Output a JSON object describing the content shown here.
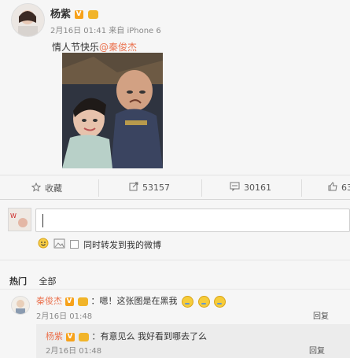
{
  "post": {
    "author": "杨紫",
    "verified_badge": "V",
    "meta": "2月16日 01:41 来自 iPhone 6",
    "text_prefix": "情人节快乐",
    "mention": "@秦俊杰"
  },
  "actions": {
    "favorite": "收藏",
    "repost_count": "53157",
    "comment_count": "30161",
    "like_count": "63"
  },
  "reply_box": {
    "sync_label": "同时转发到我的微博"
  },
  "tabs": {
    "hot": "热门",
    "all": "全部"
  },
  "comment": {
    "author": "秦俊杰",
    "verified_badge": "V",
    "text": "：嗯！这张图是在黑我",
    "time": "2月16日 01:48",
    "reply": "回复"
  },
  "nested_reply": {
    "author": "杨紫",
    "verified_badge": "V",
    "text": "：有意见么 我好看到哪去了么",
    "time": "2月16日 01:48",
    "reply": "回复"
  },
  "colors": {
    "accent": "#eb7350",
    "verified": "#f7a21b",
    "background": "#f6f6f6"
  }
}
